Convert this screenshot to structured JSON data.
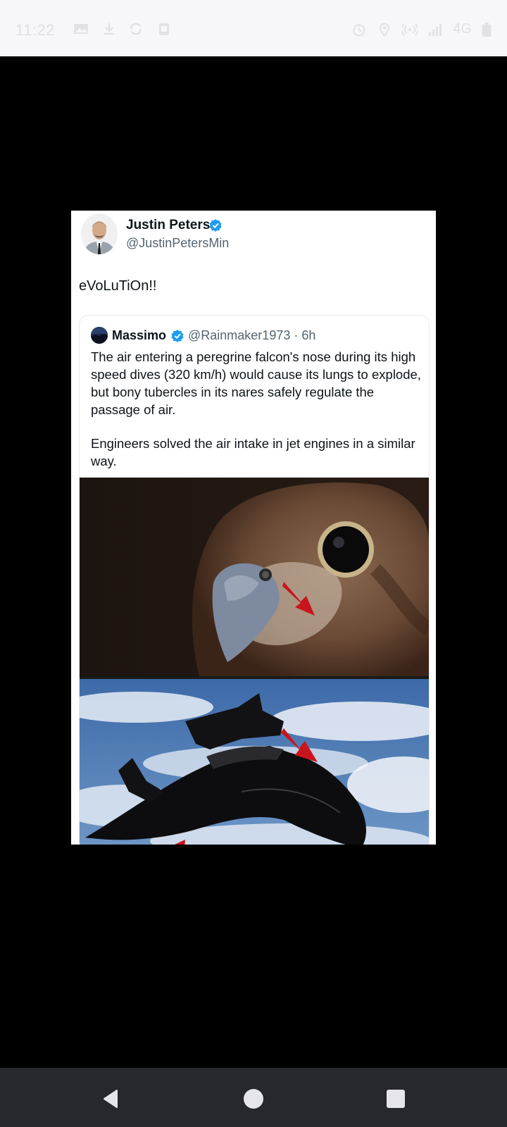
{
  "status_bar": {
    "time": "11:22",
    "network": "4G",
    "icons_left": [
      "image-icon",
      "download-icon",
      "sync-icon",
      "clipboard-icon"
    ],
    "icons_right": [
      "alarm-icon",
      "location-icon",
      "hotspot-icon",
      "signal-icon",
      "battery-icon"
    ]
  },
  "post": {
    "author_name": "Justin Peters",
    "author_handle": "@JustinPetersMin",
    "verified": true,
    "text": "eVoLuTiOn!!",
    "quoted": {
      "author_name": "Massimo",
      "author_handle": "@Rainmaker1973 · 6h",
      "verified": true,
      "paragraph_1": "The air entering a peregrine falcon's nose during its high speed dives (320 km/h) would cause its lungs to explode, but bony tubercles in its nares safely regulate the passage of air.",
      "paragraph_2": "Engineers solved the air intake in jet engines in a similar way."
    }
  },
  "nav": {
    "back": "back-icon",
    "home": "home-icon",
    "recents": "recents-icon"
  },
  "colors": {
    "verified_blue": "#1d9bf0",
    "arrow_red": "#c8151d",
    "navbar": "#27272e",
    "statusbar": "#f7f7f9"
  }
}
